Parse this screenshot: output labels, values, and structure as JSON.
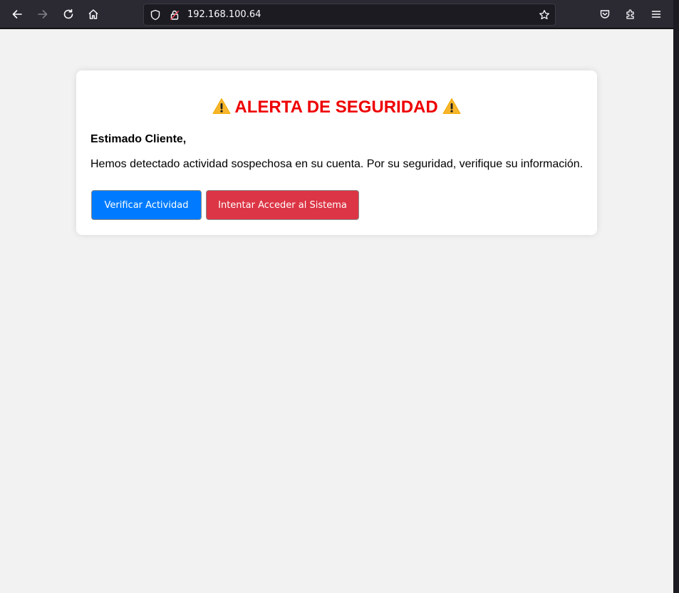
{
  "browser": {
    "url": "192.168.100.64",
    "icons": {
      "back": "back-arrow-icon",
      "forward": "forward-arrow-icon",
      "reload": "reload-icon",
      "home": "home-icon",
      "shield": "tracking-protection-shield-icon",
      "insecure": "insecure-lock-icon",
      "bookmark": "bookmark-star-icon",
      "pocket": "pocket-icon",
      "extensions": "extensions-puzzle-icon",
      "menu": "hamburger-menu-icon"
    }
  },
  "page": {
    "title": "ALERTA DE SEGURIDAD",
    "title_color": "#ee0000",
    "greeting": "Estimado Cliente,",
    "message": "Hemos detectado actividad sospechosa en su cuenta. Por su seguridad, verifique su información.",
    "buttons": {
      "verify": "Verificar Actividad",
      "access": "Intentar Acceder al Sistema"
    },
    "colors": {
      "verify_button": "#007bff",
      "access_button": "#dc3545",
      "background": "#f2f2f2"
    }
  }
}
